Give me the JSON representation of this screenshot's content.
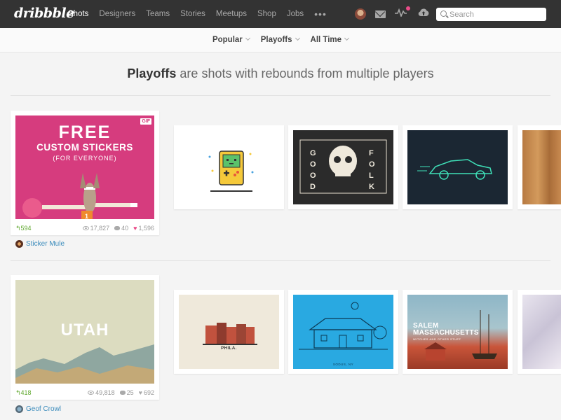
{
  "nav": {
    "logo": "dribbble",
    "items": [
      "Shots",
      "Designers",
      "Teams",
      "Stories",
      "Meetups",
      "Shop",
      "Jobs"
    ],
    "more": "•••",
    "search_placeholder": "Search",
    "accent_color": "#ea4c89"
  },
  "filters": [
    {
      "label": "Popular"
    },
    {
      "label": "Playoffs"
    },
    {
      "label": "All Time"
    }
  ],
  "headline": {
    "bold": "Playoffs",
    "rest": " are shots with rebounds from multiple players"
  },
  "rows": [
    {
      "main": {
        "title_line1": "FREE",
        "title_line2": "CUSTOM STICKERS",
        "title_line3": "(FOR EVERYONE)",
        "badge": "GIF",
        "rebounds": "594",
        "views": "17,827",
        "comments": "40",
        "likes": "1,596",
        "author": "Sticker Mule"
      },
      "rebounds": [
        {
          "label": "",
          "icon": "gameboy"
        },
        {
          "label": "",
          "icon": "skull-good-folks"
        },
        {
          "label": "",
          "icon": "sports-car"
        },
        {
          "label": "",
          "icon": "wood-texture"
        }
      ]
    },
    {
      "main": {
        "title": "UTAH",
        "rebounds": "418",
        "views": "49,818",
        "comments": "25",
        "likes": "692",
        "author": "Geof Crowl"
      },
      "rebounds": [
        {
          "label": "PHILA.",
          "icon": "rowhouses"
        },
        {
          "label": "SODUS, NY",
          "icon": "farmhouse"
        },
        {
          "title_line1": "SALEM",
          "title_line2": "MASSACHUSETTS",
          "sub": "WITCHES AND OTHER STUFF",
          "icon": "ship"
        },
        {
          "label": "",
          "icon": "glass-abstract"
        }
      ]
    }
  ]
}
